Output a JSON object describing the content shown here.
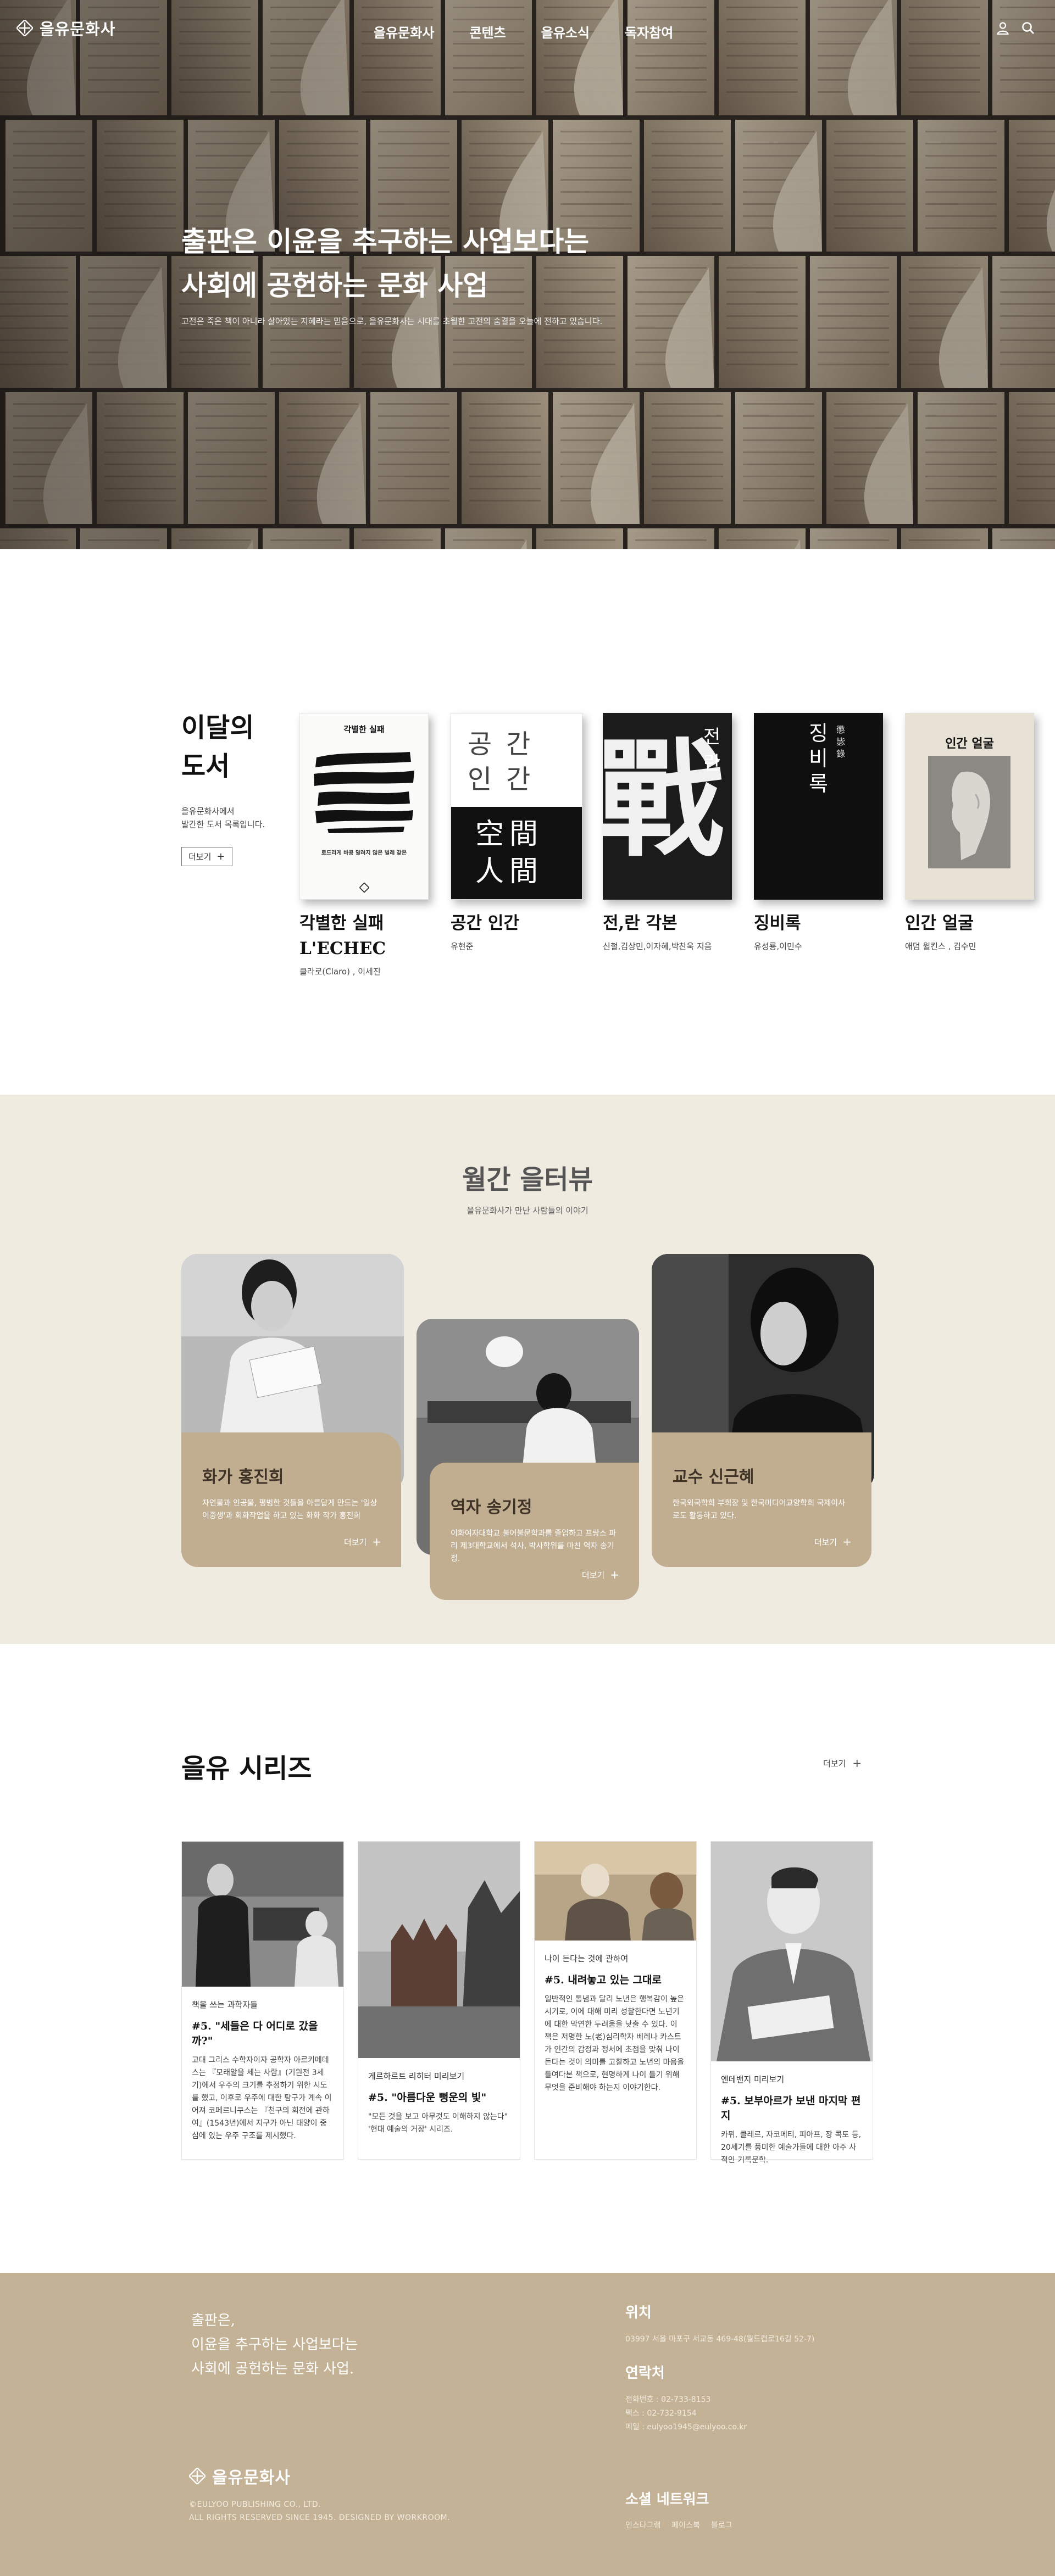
{
  "header": {
    "logo_text": "을유문화사",
    "nav": [
      "을유문화사",
      "콘텐츠",
      "을유소식",
      "독자참여"
    ]
  },
  "hero": {
    "title_line1": "출판은 이윤을 추구하는 사업보다는",
    "title_line2": "사회에 공헌하는 문화 사업",
    "subtitle": "고전은 죽은 책이 아니라 살아있는 지혜라는 믿음으로, 을유문화사는 시대를 초월한 고전의 숨결을 오늘에 전하고 있습니다."
  },
  "books": {
    "heading_line1": "이달의",
    "heading_line2": "도서",
    "desc_line1": "을유문화사에서",
    "desc_line2": "발간한 도서 목록입니다.",
    "more_label": "더보기",
    "items": [
      {
        "title_line1": "각별한 실패",
        "title_line2": "L'ECHEC",
        "author": "클라로(Claro) , 이세진",
        "cover_title": "각별한 실패",
        "cover_caption": "로드리게 바콩 알려지 않은 벌레 같은"
      },
      {
        "title_line1": "공간 인간",
        "title_line2": "",
        "author": "유현준",
        "cover_top": "공간 인간",
        "cover_bottom": "空間 人間"
      },
      {
        "title_line1": "전,란 각본",
        "title_line2": "",
        "author": "신철,김상민,이자혜,박찬욱 지음",
        "cover_glyph": "戰",
        "cover_side": "전 란"
      },
      {
        "title_line1": "징비록",
        "title_line2": "",
        "author": "유성룡,이민수",
        "cover_hanja": "懲毖錄",
        "cover_title": "징비록"
      },
      {
        "title_line1": "인간 얼굴",
        "title_line2": "",
        "author": "애덤 윌킨스 , 김수민",
        "cover_title": "인간 얼굴"
      }
    ]
  },
  "interview": {
    "title": "월간 을터뷰",
    "subtitle": "을유문화사가 만난 사람들의 이야기",
    "cards": [
      {
        "name": "화가 홍진희",
        "desc": "자연물과 인공물, 평범한 것들을 아름답게 만드는 '일상이중생'과 회화작업을 하고 있는 화화 작가 홍진희",
        "more": "더보기"
      },
      {
        "name": "역자 송기정",
        "desc": "이화여자대학교 불어불문학과를 졸업하고 프랑스 파리 제3대학교에서 석사, 박사학위를 마친 역자 송기정.",
        "more": "더보기"
      },
      {
        "name": "교수 신근혜",
        "desc": "한국외국학회 부회장 및 한국미디어교양학회 국제이사로도 활동하고 있다.",
        "more": "더보기"
      }
    ]
  },
  "series": {
    "title": "을유 시리즈",
    "more_label": "더보기",
    "cards": [
      {
        "kicker": "책을 쓰는 과학자들",
        "headline": "#5. \"세들은 다 어디로 갔을까?\"",
        "text": "고대 그리스 수학자이자 공학자 아르키메데스는 『모래알을 세는 사람』(기원전 3세기)에서 우주의 크기를 추정하기 위한 시도를 했고, 이후로 우주에 대한 탐구가 계속 이어져 코페르니쿠스는 『천구의 회전에 관하여』(1543년)에서 지구가 아닌 태양이 중심에 있는 우주 구조를 제시했다."
      },
      {
        "kicker": "게르하르트 리히터 미리보기",
        "headline": "#5. \"아름다운 뻥운의 빛\"",
        "text": "\"모든 것을 보고 아무것도 이해하지 않는다\" '현대 예술의 거장' 시리즈."
      },
      {
        "kicker": "나이 든다는 것에 관하여",
        "headline": "#5. 내려놓고 있는 그대로",
        "text": "일반적인 통념과 달리 노년은 행복감이 높은 시기로, 이에 대해 미리 성찰한다면 노년기에 대한 막연한 두려움을 낮출 수 있다. 이 책은 저명한 노(老)심리학자 베레나 카스트가 인간의 감정과 정서에 초점을 맞춰 나이 든다는 것이 의미를 고찰하고 노년의 마음을 들여다본 책으로, 현명하게 나이 들기 위해 무엇을 준비해야 하는지 이야기한다."
      },
      {
        "kicker": "엔데밴지 미리보기",
        "headline": "#5. 보부아르가 보낸 마지막 편지",
        "text": "카뮈, 클레르, 자코메티, 피아프, 장 콕토 등, 20세기를 풍미한 예술가들에 대한 아주 사적인 기록문학."
      }
    ]
  },
  "footer": {
    "tag_line1": "출판은,",
    "tag_line2": "이윤을 추구하는 사업보다는",
    "tag_line3": "사회에 공헌하는 문화 사업.",
    "logo_text": "을유문화사",
    "copy_line1": "©EULYOO PUBLISHING CO., LTD.",
    "copy_line2": "ALL RIGHTS RESERVED SINCE 1945. DESIGNED BY WORKROOM.",
    "location_title": "위치",
    "location_text": "03997 서울 마포구 서교동 469-48(월드컵로16길 52-7)",
    "contact_title": "연락처",
    "contact_phone": "전화번호 : 02-733-8153",
    "contact_fax": "팩스 : 02-732-9154",
    "contact_email": "메일 : eulyoo1945@eulyoo.co.kr",
    "social_title": "소셜 네트워크",
    "social_links": [
      "인스타그램",
      "페이스북",
      "블로그"
    ]
  }
}
